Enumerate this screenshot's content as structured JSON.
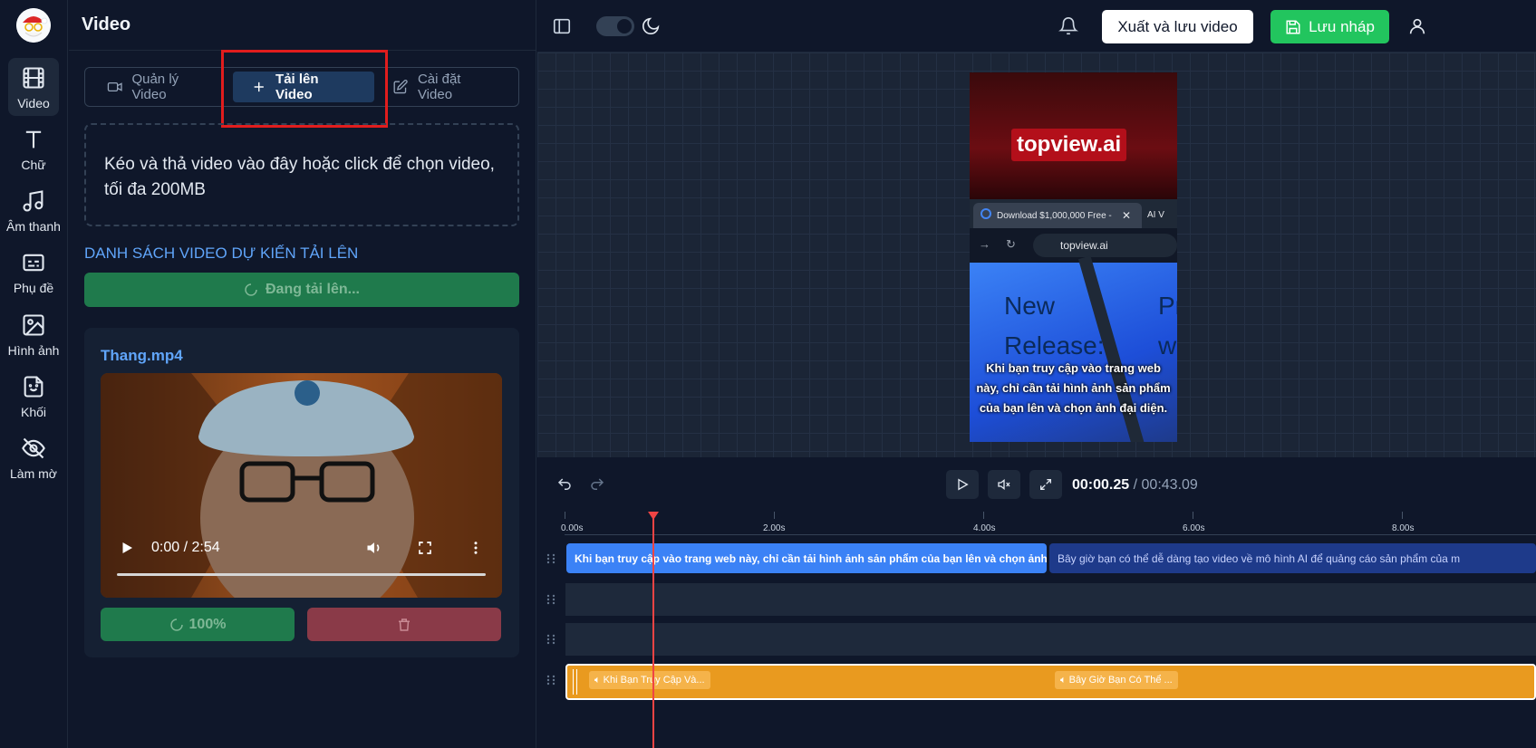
{
  "rail": {
    "items": [
      {
        "label": "Video",
        "icon": "film-icon"
      },
      {
        "label": "Chữ",
        "icon": "text-icon"
      },
      {
        "label": "Âm thanh",
        "icon": "music-icon"
      },
      {
        "label": "Phụ đề",
        "icon": "subtitles-icon"
      },
      {
        "label": "Hình ảnh",
        "icon": "image-icon"
      },
      {
        "label": "Khối",
        "icon": "sticker-icon"
      },
      {
        "label": "Làm mờ",
        "icon": "eye-off-icon"
      }
    ]
  },
  "panel": {
    "title": "Video",
    "tabs": [
      {
        "label": "Quản lý Video"
      },
      {
        "label": "Tải lên Video"
      },
      {
        "label": "Cài đặt Video"
      }
    ],
    "dropzone_text": "Kéo và thả video vào đây hoặc click để chọn video, tối đa 200MB",
    "list_title": "DANH SÁCH VIDEO DỰ KIẾN TẢI LÊN",
    "uploading_label": "Đang tải lên...",
    "file": {
      "name": "Thang.mp4",
      "player_time": "0:00 / 2:54",
      "progress_label": "100%"
    }
  },
  "topbar": {
    "export_label": "Xuất và lưu video",
    "save_label": "Lưu nháp"
  },
  "preview": {
    "brand": "topview.ai",
    "tab_title": "Download $1,000,000 Free -",
    "tab2_title": "AI V",
    "url": "topview.ai",
    "hero_text_1": "New",
    "hero_text_2": "Release:",
    "hero_text_3": "Pr",
    "hero_text_4": "w",
    "caption": "Khi bạn truy cập vào trang web này, chỉ cần tải hình ảnh sản phẩm của bạn lên và chọn ảnh đại diện."
  },
  "controls": {
    "current_time": "00:00.25",
    "separator": "/",
    "total_time": "00:43.09"
  },
  "timeline": {
    "ticks": [
      "0.00s",
      "2.00s",
      "4.00s",
      "6.00s",
      "8.00s"
    ],
    "subtitle_clips": [
      "Khi bạn truy cập vào trang web này, chỉ cần tải hình ảnh sản phẩm của bạn lên và chọn ảnh đại diện.",
      "Bây giờ bạn có thể dễ dàng tạo video về mô hình AI để quảng cáo sản phẩm của m"
    ],
    "audio_clips": [
      "Khi Bạn Truy Cập Và...",
      "Bây Giờ Bạn Có Thể ..."
    ]
  },
  "colors": {
    "accent": "#3b82f6",
    "save": "#22c55e",
    "audio": "#e99a1f",
    "playhead": "#ef4444",
    "highlight": "#e11d1d"
  }
}
